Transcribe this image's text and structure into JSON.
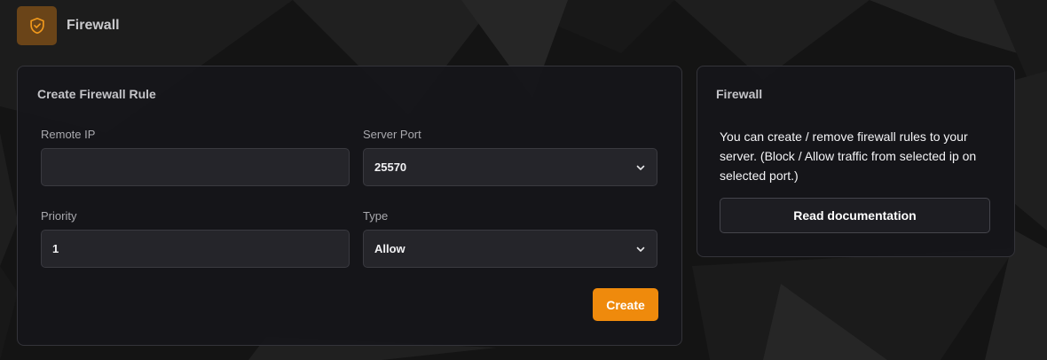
{
  "colors": {
    "accent": "#ef8a0c",
    "icon_background": "#6a4418",
    "card_background": "#16161a",
    "field_background": "#25252a"
  },
  "header": {
    "title": "Firewall",
    "icon": "shield-check-icon"
  },
  "create_rule": {
    "title": "Create Firewall Rule",
    "remote_ip": {
      "label": "Remote IP",
      "value": "",
      "placeholder": ""
    },
    "server_port": {
      "label": "Server Port",
      "selected": "25570",
      "icon": "chevron-down-icon"
    },
    "priority": {
      "label": "Priority",
      "value": "1"
    },
    "type": {
      "label": "Type",
      "selected": "Allow",
      "icon": "chevron-down-icon"
    },
    "create_label": "Create"
  },
  "info": {
    "title": "Firewall",
    "description": "You can create / remove firewall rules to your server. (Block / Allow traffic from selected ip on selected port.)",
    "docs_label": "Read documentation"
  }
}
